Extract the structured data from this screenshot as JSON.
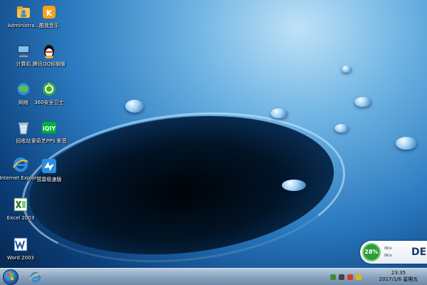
{
  "desktop_icons": [
    {
      "label": "Administra...",
      "icon": "user-folder-icon"
    },
    {
      "label": "酷我音乐",
      "icon": "kuwo-music-icon"
    },
    {
      "label": "计算机",
      "icon": "computer-icon"
    },
    {
      "label": "腾讯QQ轻聊版",
      "icon": "qq-penguin-icon"
    },
    {
      "label": "网络",
      "icon": "network-icon"
    },
    {
      "label": "360安全卫士",
      "icon": "360-security-icon"
    },
    {
      "label": "回收站",
      "icon": "recycle-bin-icon"
    },
    {
      "label": "爱奇艺PPS 影音",
      "icon": "iqiyi-icon"
    },
    {
      "label": "Internet Explorer",
      "icon": "internet-explorer-icon"
    },
    {
      "label": "迅雷极速版",
      "icon": "xunlei-icon"
    },
    {
      "label": "Excel 2003",
      "icon": "excel-icon"
    },
    {
      "label": "Word 2003",
      "icon": "word-icon"
    }
  ],
  "widget": {
    "percent": "28%",
    "stat_up": "0K/s",
    "stat_down": "0K/s",
    "brand": "DE"
  },
  "taskbar": {
    "start_icon": "windows-start-orb",
    "pinned": [
      "internet-explorer-icon"
    ],
    "tray_icons": [
      "action-center-icon",
      "network-tray-icon",
      "volume-icon",
      "ime-icon"
    ]
  },
  "clock": {
    "time": "23:35",
    "date": "2017/1/6 星期五"
  },
  "colors": {
    "taskbar": "#8aa4bf",
    "wallpaper_deep": "#062347",
    "widget_ring": "#2e9a3c"
  }
}
